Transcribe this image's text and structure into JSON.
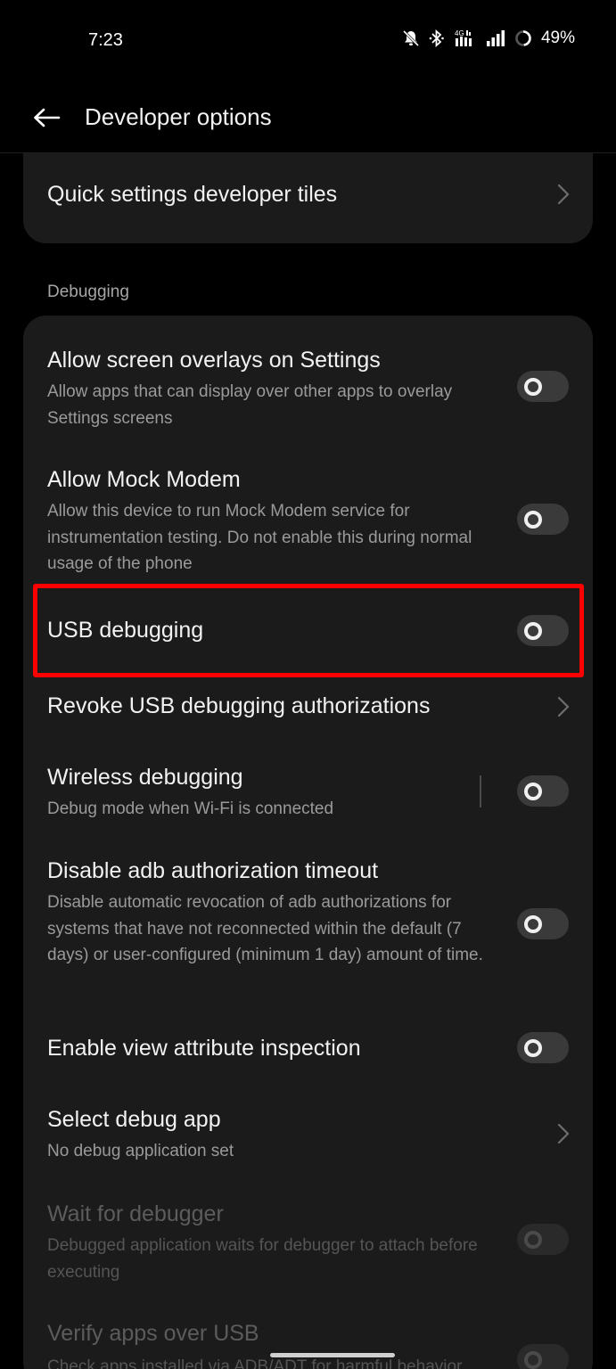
{
  "status_bar": {
    "time": "7:23",
    "battery": "49%",
    "network": "4G",
    "icons": [
      "mute-icon",
      "bluetooth-icon",
      "data-icon",
      "signal-icon",
      "battery-icon"
    ]
  },
  "app_bar": {
    "title": "Developer options",
    "back_icon": "back-arrow-icon"
  },
  "top_card": {
    "title": "Quick settings developer tiles"
  },
  "section": {
    "header": "Debugging"
  },
  "items": [
    {
      "title": "Allow screen overlays on Settings",
      "subtitle": "Allow apps that can display over other apps to overlay Settings screens",
      "control": "toggle",
      "on": false,
      "enabled": true
    },
    {
      "title": "Allow Mock Modem",
      "subtitle": "Allow this device to run Mock Modem service for instrumentation testing. Do not enable this during normal usage of the phone",
      "control": "toggle",
      "on": false,
      "enabled": true
    },
    {
      "title": "USB debugging",
      "subtitle": "",
      "control": "toggle",
      "on": false,
      "enabled": true,
      "highlighted": true
    },
    {
      "title": "Revoke USB debugging authorizations",
      "subtitle": "",
      "control": "chevron",
      "enabled": true
    },
    {
      "title": "Wireless debugging",
      "subtitle": "Debug mode when Wi-Fi is connected",
      "control": "toggle",
      "on": false,
      "enabled": true
    },
    {
      "title": "Disable adb authorization timeout",
      "subtitle": "Disable automatic revocation of adb authorizations for systems that have not reconnected within the default (7 days) or user-configured (minimum 1 day) amount of time.",
      "control": "toggle",
      "on": false,
      "enabled": true
    },
    {
      "title": "Enable view attribute inspection",
      "subtitle": "",
      "control": "toggle",
      "on": false,
      "enabled": true
    },
    {
      "title": "Select debug app",
      "subtitle": "No debug application set",
      "control": "chevron",
      "enabled": true
    },
    {
      "title": "Wait for debugger",
      "subtitle": "Debugged application waits for debugger to attach before executing",
      "control": "toggle",
      "on": false,
      "enabled": false
    },
    {
      "title": "Verify apps over USB",
      "subtitle": "Check apps installed via ADB/ADT for harmful behavior",
      "control": "toggle",
      "on": false,
      "enabled": false
    }
  ],
  "colors": {
    "background": "#000000",
    "card": "#1b1b1b",
    "highlight": "#ff0000",
    "toggle_off": "#3a3a3a"
  }
}
